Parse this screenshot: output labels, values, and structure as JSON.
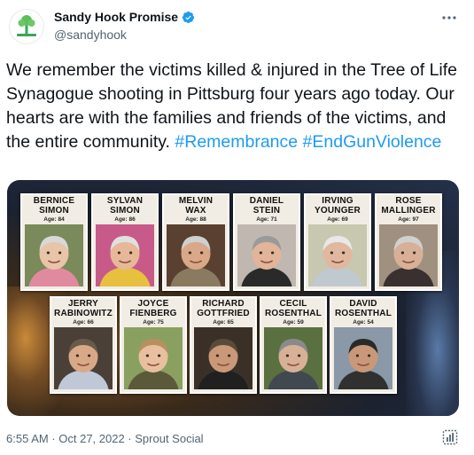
{
  "account": {
    "display_name": "Sandy Hook Promise",
    "handle": "@sandyhook",
    "avatar_icon": "tree-logo-icon",
    "verified_color": "#1d9bf0"
  },
  "tweet": {
    "text": "We remember the victims killed & injured in the Tree of Life Synagogue shooting in Pittsburg four years ago today. Our hearts are with the families and friends of the victims, and the entire community.",
    "hashtags": "#Remembrance #EndGunViolence",
    "hashtag_color": "#1d9bf0"
  },
  "media": {
    "victims_row1": [
      {
        "name": "BERNICE\nSIMON",
        "age": "Age: 84"
      },
      {
        "name": "SYLVAN\nSIMON",
        "age": "Age: 86"
      },
      {
        "name": "MELVIN\nWAX",
        "age": "Age: 88"
      },
      {
        "name": "DANIEL\nSTEIN",
        "age": "Age: 71"
      },
      {
        "name": "IRVING\nYOUNGER",
        "age": "Age: 69"
      },
      {
        "name": "ROSE\nMALLINGER",
        "age": "Age: 97"
      }
    ],
    "victims_row2": [
      {
        "name": "JERRY\nRABINOWITZ",
        "age": "Age: 66"
      },
      {
        "name": "JOYCE\nFIENBERG",
        "age": "Age: 75"
      },
      {
        "name": "RICHARD\nGOTTFRIED",
        "age": "Age: 65"
      },
      {
        "name": "CECIL\nROSENTHAL",
        "age": "Age: 59"
      },
      {
        "name": "DAVID\nROSENTHAL",
        "age": "Age: 54"
      }
    ]
  },
  "footer": {
    "timestamp": "6:55 AM · Oct 27, 2022 · ",
    "source": "Sprout Social",
    "analytics_icon": "analytics-icon"
  }
}
